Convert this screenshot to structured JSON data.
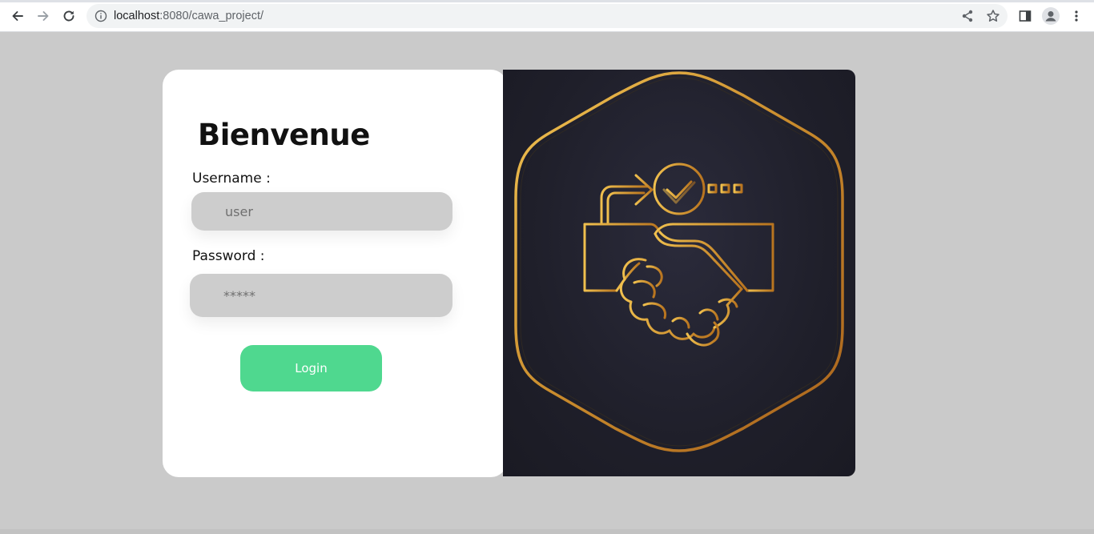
{
  "browser": {
    "url_host": "localhost",
    "url_rest": ":8080/cawa_project/",
    "icons": {
      "back": "back-arrow-icon",
      "forward": "forward-arrow-icon",
      "reload": "reload-icon",
      "site_info": "info-icon",
      "share": "share-icon",
      "bookmark": "star-icon",
      "side_panel": "side-panel-icon",
      "profile": "profile-icon",
      "menu": "kebab-menu-icon"
    }
  },
  "login": {
    "title": "Bienvenue",
    "username_label": "Username :",
    "username_placeholder": "user",
    "password_label": "Password :",
    "password_placeholder": "*****",
    "login_button": "Login"
  },
  "colors": {
    "page_bg": "#cacaca",
    "card_bg": "#ffffff",
    "field_bg": "#cdcdcd",
    "button_bg": "#4fd88f",
    "illustration_bg": "#1f1f2a",
    "gold": "#d4a038"
  },
  "illustration": {
    "icon": "handshake-agreement-icon"
  }
}
